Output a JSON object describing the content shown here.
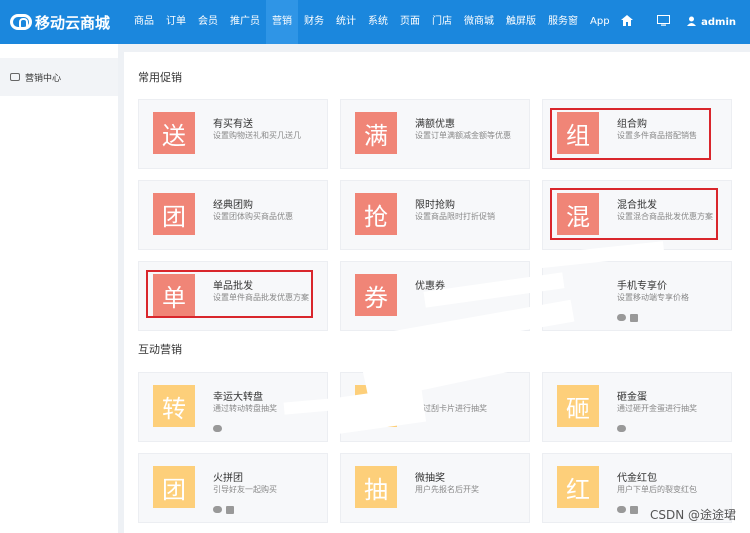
{
  "header": {
    "logo_text": "移动云商城",
    "nav": [
      "商品",
      "订单",
      "会员",
      "推广员",
      "营销",
      "财务",
      "统计",
      "系统",
      "页面",
      "门店",
      "微商城",
      "触屏版",
      "服务窗",
      "App"
    ],
    "active_index": 4,
    "user": "admin"
  },
  "sidebar": {
    "items": [
      {
        "label": "营销中心"
      }
    ]
  },
  "sections": [
    {
      "title": "常用促销",
      "cards": [
        {
          "char": "送",
          "title": "有买有送",
          "desc": "设置购物送礼和买几送几",
          "color": "red"
        },
        {
          "char": "满",
          "title": "满额优惠",
          "desc": "设置订单满额减金额等优惠",
          "color": "red"
        },
        {
          "char": "组",
          "title": "组合购",
          "desc": "设置多件商品搭配销售",
          "color": "red"
        },
        {
          "char": "团",
          "title": "经典团购",
          "desc": "设置团体购买商品优惠",
          "color": "red"
        },
        {
          "char": "抢",
          "title": "限时抢购",
          "desc": "设置商品限时打折促销",
          "color": "red"
        },
        {
          "char": "混",
          "title": "混合批发",
          "desc": "设置混合商品批发优惠方案",
          "color": "red"
        },
        {
          "char": "单",
          "title": "单品批发",
          "desc": "设置单件商品批发优惠方案",
          "color": "red"
        },
        {
          "char": "券",
          "title": "优惠券",
          "desc": "",
          "color": "red"
        },
        {
          "char": "",
          "title": "手机专享价",
          "desc": "设置移动端专享价格",
          "color": "red"
        }
      ]
    },
    {
      "title": "互动营销",
      "cards": [
        {
          "char": "转",
          "title": "幸运大转盘",
          "desc": "通过转动转盘抽奖",
          "color": "yellow"
        },
        {
          "char": "",
          "title": "",
          "desc": "通过刮卡片进行抽奖",
          "color": "yellow"
        },
        {
          "char": "砸",
          "title": "砸金蛋",
          "desc": "通过砸开金蛋进行抽奖",
          "color": "yellow"
        },
        {
          "char": "团",
          "title": "火拼团",
          "desc": "引导好友一起购买",
          "color": "yellow"
        },
        {
          "char": "抽",
          "title": "微抽奖",
          "desc": "用户先报名后开奖",
          "color": "yellow"
        },
        {
          "char": "红",
          "title": "代金红包",
          "desc": "用户下单后的裂变红包",
          "color": "yellow"
        }
      ]
    }
  ],
  "watermark": "CSDN @途途珺"
}
